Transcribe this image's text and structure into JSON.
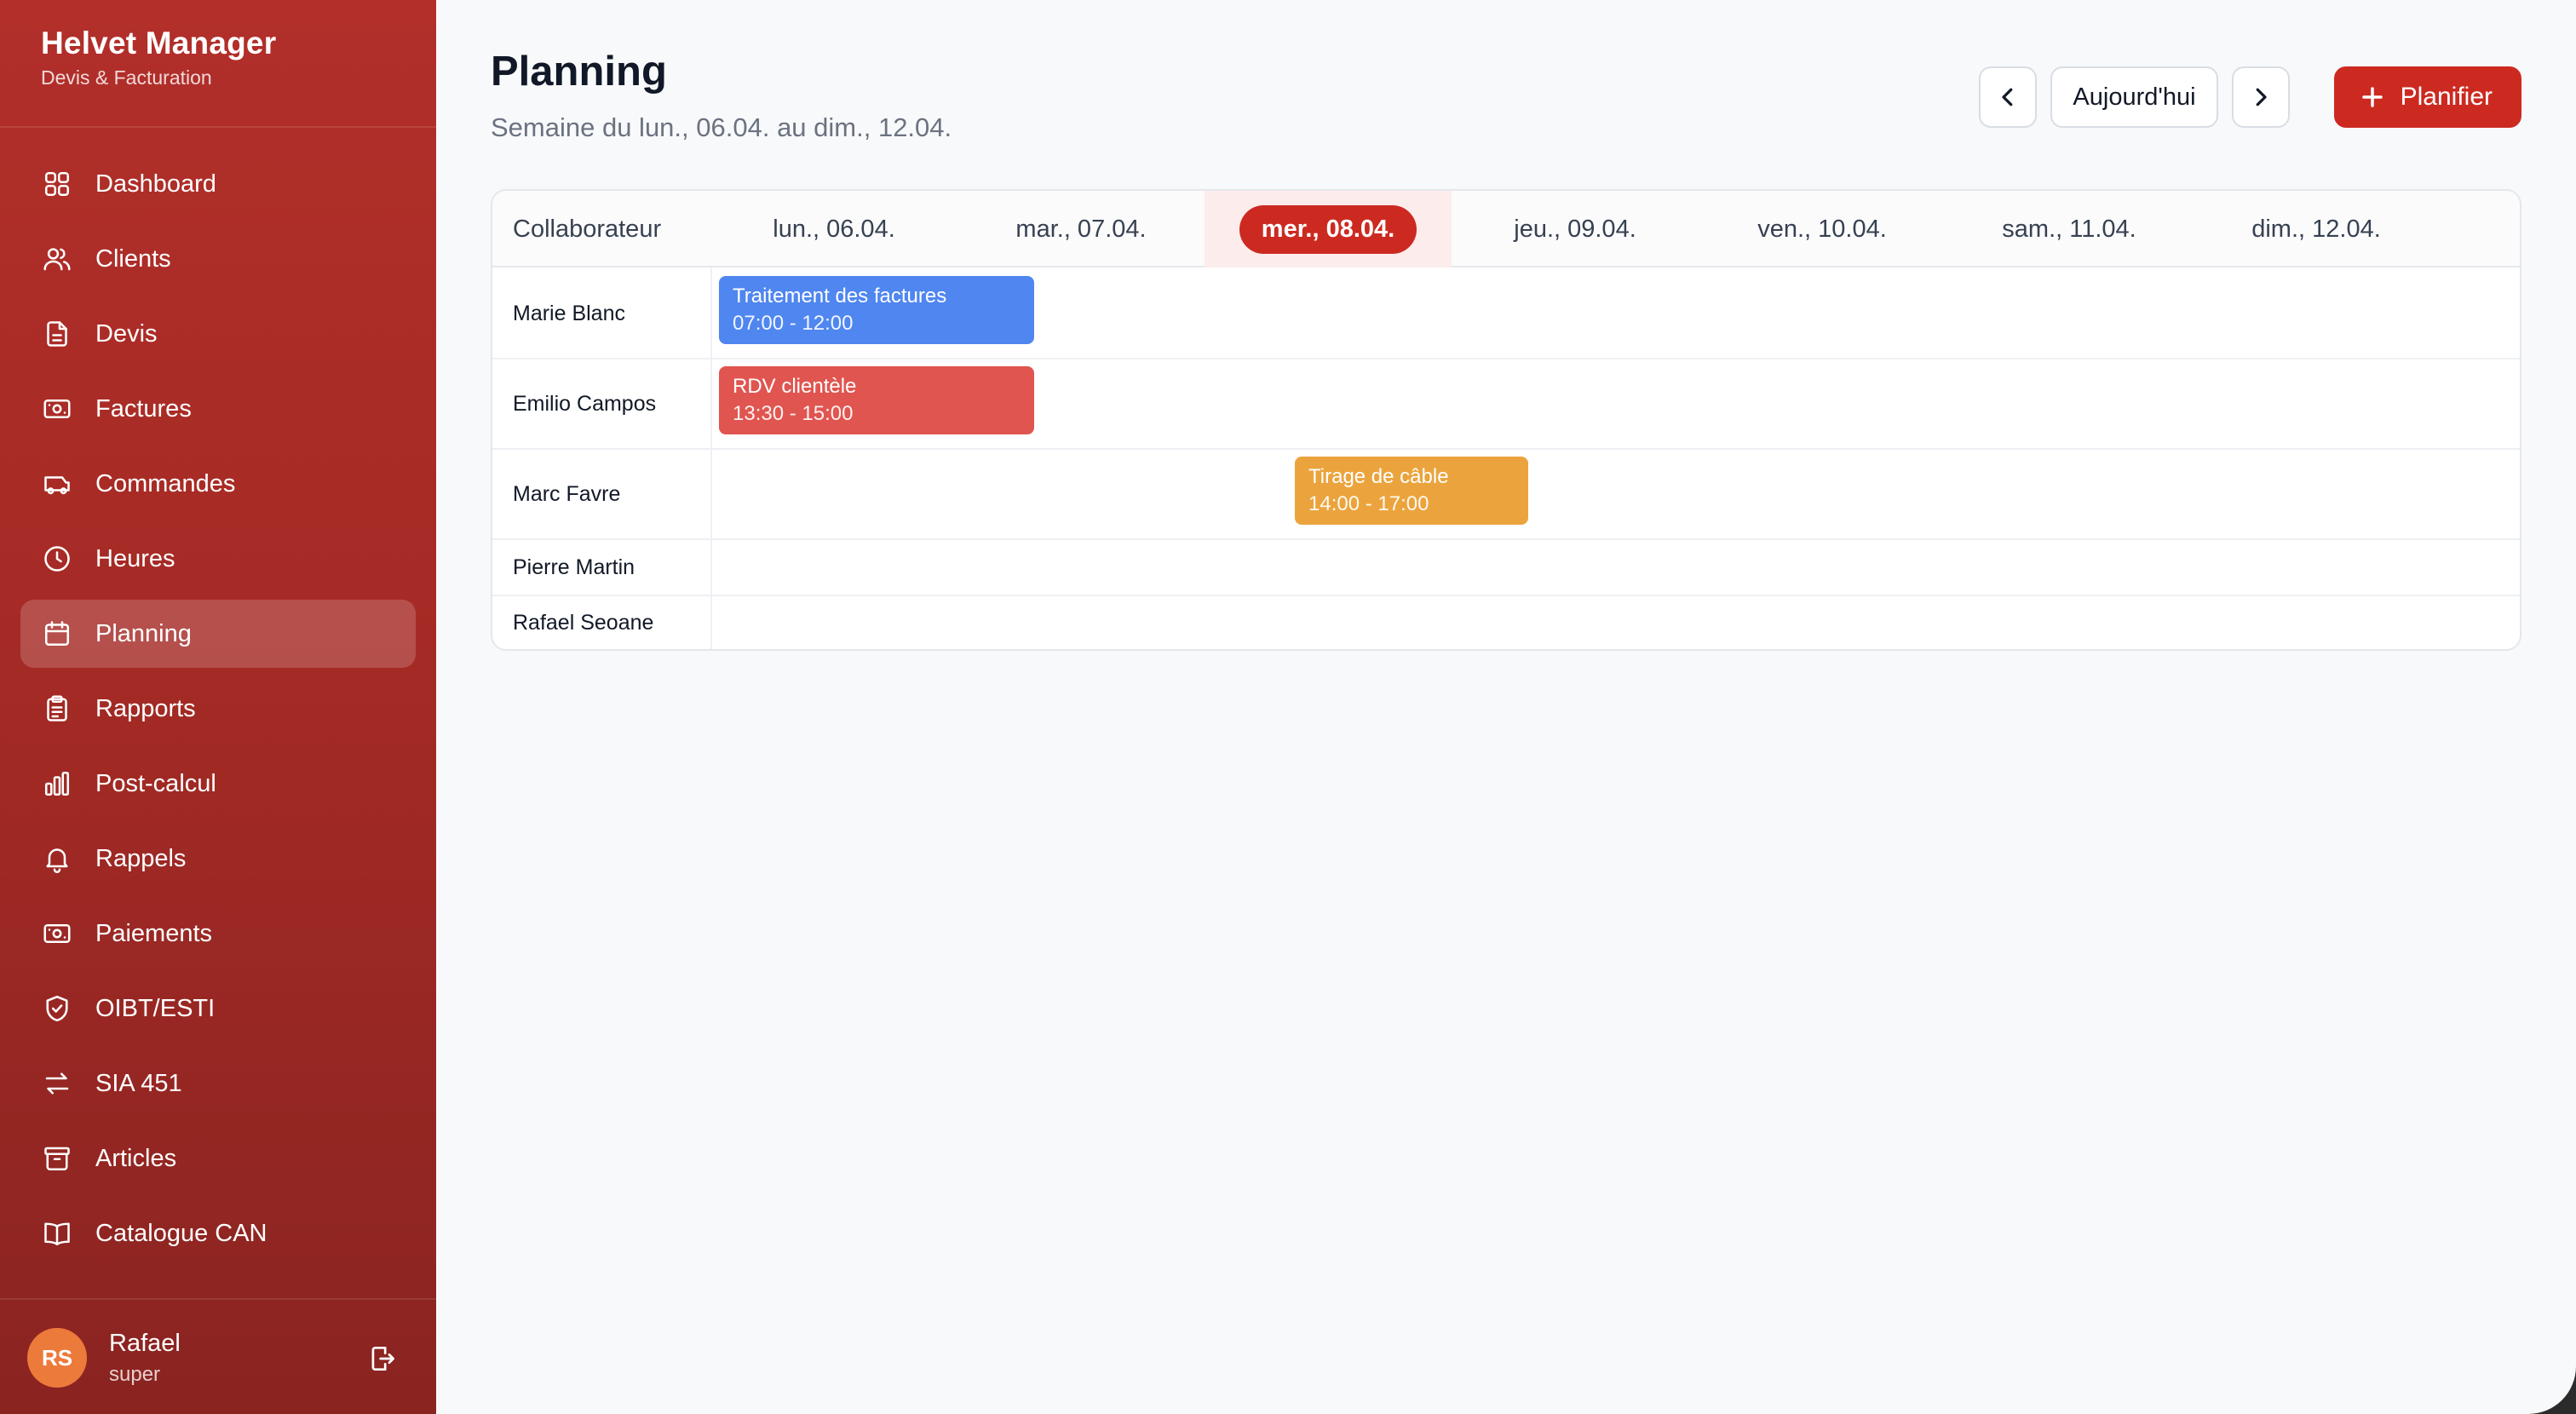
{
  "app": {
    "title": "Helvet Manager",
    "subtitle": "Devis & Facturation"
  },
  "sidebar": {
    "items": [
      {
        "label": "Dashboard",
        "icon": "dashboard-icon"
      },
      {
        "label": "Clients",
        "icon": "users-icon"
      },
      {
        "label": "Devis",
        "icon": "document-icon"
      },
      {
        "label": "Factures",
        "icon": "banknote-icon"
      },
      {
        "label": "Commandes",
        "icon": "truck-icon"
      },
      {
        "label": "Heures",
        "icon": "clock-icon"
      },
      {
        "label": "Planning",
        "icon": "calendar-icon",
        "active": true
      },
      {
        "label": "Rapports",
        "icon": "clipboard-icon"
      },
      {
        "label": "Post-calcul",
        "icon": "bar-chart-icon"
      },
      {
        "label": "Rappels",
        "icon": "bell-icon"
      },
      {
        "label": "Paiements",
        "icon": "banknote-icon"
      },
      {
        "label": "OIBT/ESTI",
        "icon": "shield-check-icon"
      },
      {
        "label": "SIA 451",
        "icon": "arrows-exchange-icon"
      },
      {
        "label": "Articles",
        "icon": "archive-icon"
      },
      {
        "label": "Catalogue CAN",
        "icon": "book-icon"
      }
    ]
  },
  "user": {
    "initials": "RS",
    "name": "Rafael",
    "role": "super",
    "avatar_color": "#ec7a3b"
  },
  "header": {
    "title": "Planning",
    "subtitle": "Semaine du lun., 06.04. au dim., 12.04.",
    "today_label": "Aujourd'hui",
    "primary_label": "Planifier"
  },
  "planning": {
    "collaborator_header": "Collaborateur",
    "days": [
      {
        "label": "lun., 06.04."
      },
      {
        "label": "mar., 07.04."
      },
      {
        "label": "mer., 08.04.",
        "today": true
      },
      {
        "label": "jeu., 09.04."
      },
      {
        "label": "ven., 10.04."
      },
      {
        "label": "sam., 11.04."
      },
      {
        "label": "dim., 12.04."
      }
    ],
    "rows": [
      {
        "name": "Marie Blanc"
      },
      {
        "name": "Emilio Campos"
      },
      {
        "name": "Marc Favre"
      },
      {
        "name": "Pierre Martin"
      },
      {
        "name": "Rafael Seoane"
      }
    ],
    "events": [
      {
        "title": "Traitement des factures",
        "time": "07:00 - 12:00",
        "color": "#4f86f0",
        "row": 0,
        "day": 0
      },
      {
        "title": "RDV clientèle",
        "time": "13:30 - 15:00",
        "color": "#e05550",
        "row": 1,
        "day": 0
      },
      {
        "title": "Tirage de câble",
        "time": "14:00 - 17:00",
        "color": "#eba43d",
        "row": 2,
        "day": 2
      }
    ]
  },
  "colors": {
    "sidebar": "#b22f2a",
    "accent": "#cc2a21",
    "today_column": "#fdecec"
  }
}
